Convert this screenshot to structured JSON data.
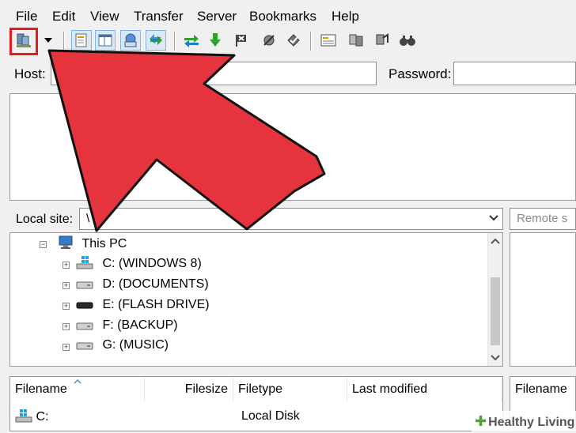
{
  "menu": [
    "File",
    "Edit",
    "View",
    "Transfer",
    "Server",
    "Bookmarks",
    "Help"
  ],
  "toolbar": {
    "buttons": [
      {
        "name": "site-manager-icon"
      },
      {
        "name": "dropdown-arrow-icon"
      },
      {
        "name": "message-log-toggle-icon"
      },
      {
        "name": "local-tree-toggle-icon"
      },
      {
        "name": "remote-tree-toggle-icon"
      },
      {
        "name": "queue-toggle-icon"
      },
      {
        "name": "refresh-icon"
      },
      {
        "name": "process-queue-icon"
      },
      {
        "name": "cancel-operation-icon"
      },
      {
        "name": "disconnect-icon"
      },
      {
        "name": "reconnect-icon"
      },
      {
        "name": "directory-listing-filters-icon"
      },
      {
        "name": "compare-directories-icon"
      },
      {
        "name": "synchronized-browsing-icon"
      },
      {
        "name": "search-files-icon"
      }
    ]
  },
  "quickconnect": {
    "host_label": "Host:",
    "host_value": "",
    "password_label": "Password:",
    "password_value": ""
  },
  "local_site": {
    "label": "Local site:",
    "path": "\\"
  },
  "remote_site": {
    "label": "Remote s"
  },
  "tree": [
    {
      "label": "This PC",
      "type": "computer"
    },
    {
      "label": "C: (WINDOWS 8)",
      "type": "windows-drive"
    },
    {
      "label": "D: (DOCUMENTS)",
      "type": "drive"
    },
    {
      "label": "E: (FLASH DRIVE)",
      "type": "flash-drive"
    },
    {
      "label": "F: (BACKUP)",
      "type": "drive"
    },
    {
      "label": "G: (MUSIC)",
      "type": "drive"
    }
  ],
  "file_list": {
    "columns": [
      "Filename",
      "Filesize",
      "Filetype",
      "Last modified"
    ],
    "rows": [
      {
        "filename": "C:",
        "filesize": "",
        "filetype": "Local Disk",
        "last_modified": ""
      }
    ]
  },
  "remote_file_list": {
    "columns": [
      "Filename"
    ]
  },
  "watermark": {
    "text": "Healthy Living"
  },
  "colors": {
    "highlight": "#e31b23",
    "arrow": "#e5343d"
  }
}
